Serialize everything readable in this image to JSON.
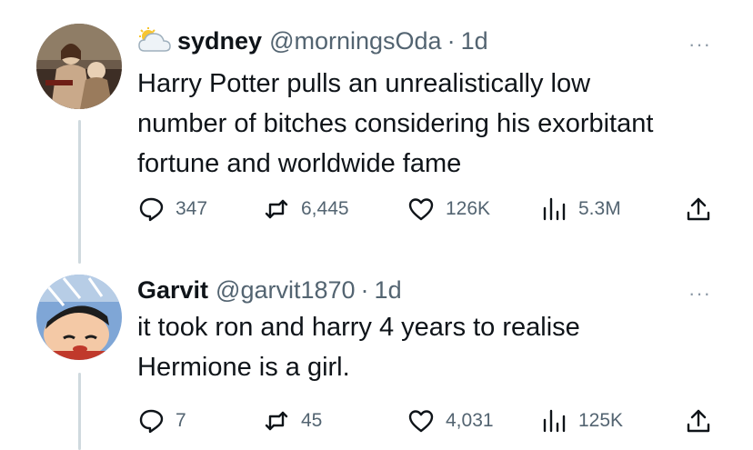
{
  "tweets": [
    {
      "emoji": "sun-behind-cloud",
      "name": "sydney",
      "handle": "@morningsOda",
      "separator": "·",
      "time": "1d",
      "more": "···",
      "lines": [
        "Harry Potter pulls an unrealistically low",
        "number of bitches considering his exorbitant",
        "fortune and worldwide fame"
      ],
      "replies": "347",
      "retweets": "6,445",
      "likes": "126K",
      "views": "5.3M"
    },
    {
      "name": "Garvit",
      "handle": "@garvit1870",
      "separator": "·",
      "time": "1d",
      "more": "···",
      "lines": [
        "it took ron and harry 4 years to realise",
        "Hermione is a girl."
      ],
      "replies": "7",
      "retweets": "45",
      "likes": "4,031",
      "views": "125K"
    }
  ],
  "colors": {
    "text": "#0f1419",
    "muted": "#536471",
    "thread_line": "#cfd9de"
  }
}
